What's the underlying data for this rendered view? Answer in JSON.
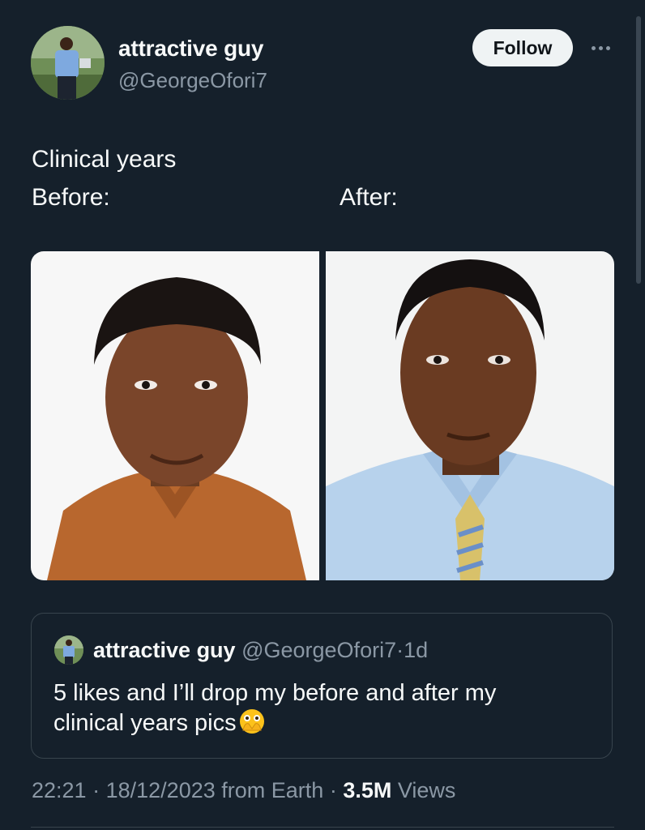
{
  "author": {
    "display_name": "attractive guy",
    "handle": "@GeorgeOfori7",
    "avatar_icon": "profile-photo-man-blue-shirt"
  },
  "actions": {
    "follow_label": "Follow",
    "more_icon": "more-horizontal-icon"
  },
  "tweet": {
    "lines": [
      "Clinical years",
      "Before:",
      "After:"
    ]
  },
  "media": {
    "before_photo": "portrait-orange-shirt",
    "after_photo": "portrait-blue-shirt-striped-tie"
  },
  "quote": {
    "display_name": "attractive guy",
    "handle": "@GeorgeOfori7",
    "separator": "·",
    "age": "1d",
    "text_line1": "5 likes and I’ll drop my before and after my",
    "text_line2": "clinical years pics",
    "emoji": "face-with-open-eyes-and-hand-over-mouth"
  },
  "meta": {
    "time": "22:21",
    "dot1": "·",
    "date": "18/12/2023",
    "source": "from Earth",
    "dot2": "·",
    "views_count": "3.5M",
    "views_label": "Views"
  },
  "colors": {
    "background": "#15202b",
    "text": "#f7f9f9",
    "secondary": "#8b98a5",
    "border": "#38444d",
    "follow_bg": "#eff3f4"
  }
}
